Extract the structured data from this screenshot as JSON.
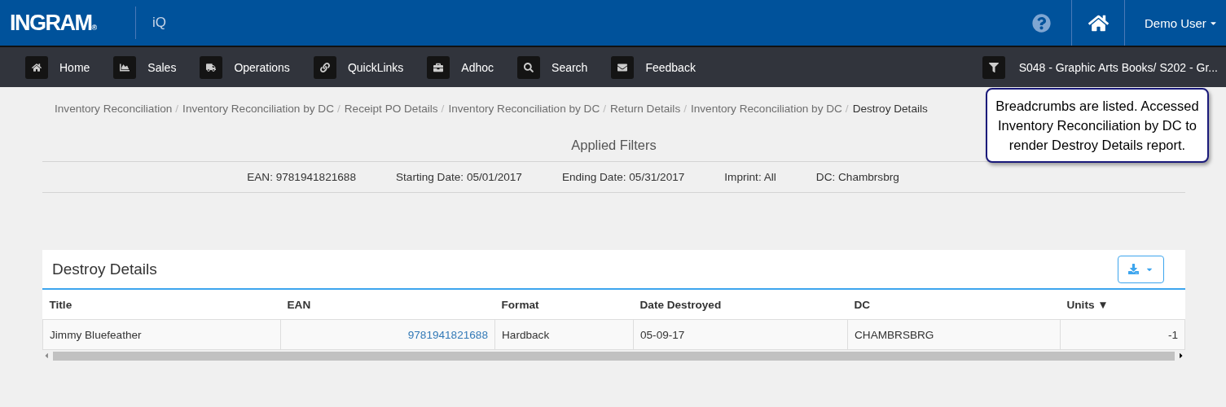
{
  "header": {
    "logo": "INGRAM",
    "logo_mark": "®",
    "app_name": "iQ",
    "user": "Demo User"
  },
  "nav": [
    {
      "kind": "home",
      "label": "Home"
    },
    {
      "kind": "sales",
      "label": "Sales"
    },
    {
      "kind": "operations",
      "label": "Operations"
    },
    {
      "kind": "links",
      "label": "QuickLinks"
    },
    {
      "kind": "adhoc",
      "label": "Adhoc"
    },
    {
      "kind": "search",
      "label": "Search"
    },
    {
      "kind": "feedback",
      "label": "Feedback"
    }
  ],
  "account_filter": "S048 - Graphic Arts Books/ S202 - Gr...",
  "breadcrumb_separator": "/",
  "breadcrumbs": [
    {
      "label": "Inventory Reconciliation",
      "selected": false
    },
    {
      "label": "Inventory Reconciliation by DC",
      "selected": false
    },
    {
      "label": "Receipt PO Details",
      "selected": false
    },
    {
      "label": "Inventory Reconciliation by DC",
      "selected": false
    },
    {
      "label": "Return Details",
      "selected": false
    },
    {
      "label": "Inventory Reconciliation by DC",
      "selected": false
    },
    {
      "label": "Destroy Details",
      "selected": true
    }
  ],
  "callout": "Breadcrumbs are listed. Accessed Inventory Reconciliation by DC to render Destroy Details report.",
  "applied_filters": {
    "title": "Applied Filters",
    "items": [
      "EAN: 9781941821688",
      "Starting Date: 05/01/2017",
      "Ending Date: 05/31/2017",
      "Imprint: All",
      "DC: Chambrsbrg"
    ]
  },
  "panel": {
    "title": "Destroy Details",
    "table": {
      "columns": [
        {
          "label": "Title",
          "kind": "text"
        },
        {
          "label": "EAN",
          "kind": "number"
        },
        {
          "label": "Format",
          "kind": "text"
        },
        {
          "label": "Date Destroyed",
          "kind": "text"
        },
        {
          "label": "DC",
          "kind": "text"
        },
        {
          "label": "Units ▼",
          "kind": "number"
        }
      ],
      "rows": [
        {
          "cells": [
            {
              "text": "Jimmy Bluefeather",
              "link": false
            },
            {
              "text": "9781941821688",
              "link": true
            },
            {
              "text": "Hardback",
              "link": false
            },
            {
              "text": "05-09-17",
              "link": false
            },
            {
              "text": "CHAMBRSBRG",
              "link": false
            },
            {
              "text": "-1",
              "link": false
            }
          ]
        }
      ]
    }
  }
}
